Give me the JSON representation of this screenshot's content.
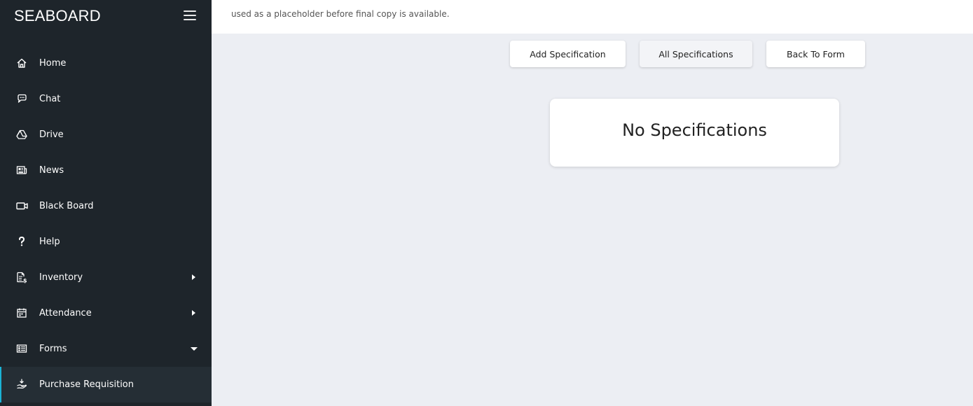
{
  "brand": "SEABOARD",
  "topbar": {
    "marquee": "used as a placeholder before final copy is available."
  },
  "sidebar": {
    "items": [
      {
        "label": "Home",
        "icon": "home-icon"
      },
      {
        "label": "Chat",
        "icon": "chat-icon"
      },
      {
        "label": "Drive",
        "icon": "drive-icon"
      },
      {
        "label": "News",
        "icon": "news-icon"
      },
      {
        "label": "Black Board",
        "icon": "video-icon"
      },
      {
        "label": "Help",
        "icon": "help-icon"
      },
      {
        "label": "Inventory",
        "icon": "invoice-icon",
        "expandable": true
      },
      {
        "label": "Attendance",
        "icon": "calendar-icon",
        "expandable": true
      },
      {
        "label": "Forms",
        "icon": "forms-icon",
        "expanded": true
      },
      {
        "label": "Purchase Requisition",
        "icon": "hand-coin-icon",
        "active": true
      }
    ]
  },
  "actions": {
    "add": "Add Specification",
    "all": "All Specifications",
    "back": "Back To Form"
  },
  "empty_state": {
    "title": "No Specifications"
  },
  "colors": {
    "sidebar_bg": "#1e252b",
    "content_bg": "#eceef3",
    "accent": "#1bb3d6"
  }
}
